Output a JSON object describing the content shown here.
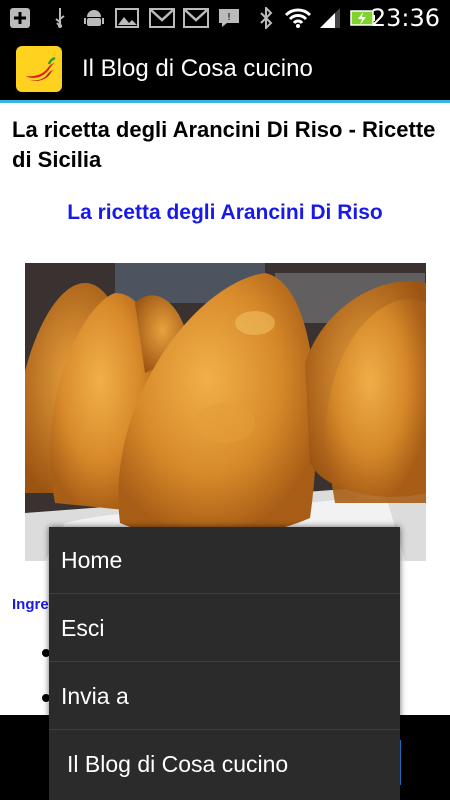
{
  "status_bar": {
    "time": "23:36",
    "icons": [
      "usb-plus-icon",
      "usb-icon",
      "android-debug-icon",
      "image-icon",
      "gmail-icon",
      "gmail-icon",
      "chat-icon",
      "bluetooth-icon",
      "wifi-icon",
      "signal-icon",
      "battery-charging-icon"
    ]
  },
  "action_bar": {
    "title": "Il Blog di Cosa cucino",
    "logo_icon": "chili-pepper-icon"
  },
  "article": {
    "title": "La ricetta degli Arancini Di Riso - Ricette di Sicilia",
    "recipe_heading": "La ricetta degli Arancini Di Riso",
    "ingredients_label": "Ingre"
  },
  "menu": {
    "items": [
      {
        "label": "Home"
      },
      {
        "label": "Esci"
      },
      {
        "label": "Invia a"
      },
      {
        "label": "Il Blog di Cosa cucino"
      }
    ]
  },
  "colors": {
    "accent": "#33b5e5",
    "link_blue": "#1a1ae6",
    "menu_bg": "#2b2b2b",
    "logo_bg": "#ffd21f"
  }
}
